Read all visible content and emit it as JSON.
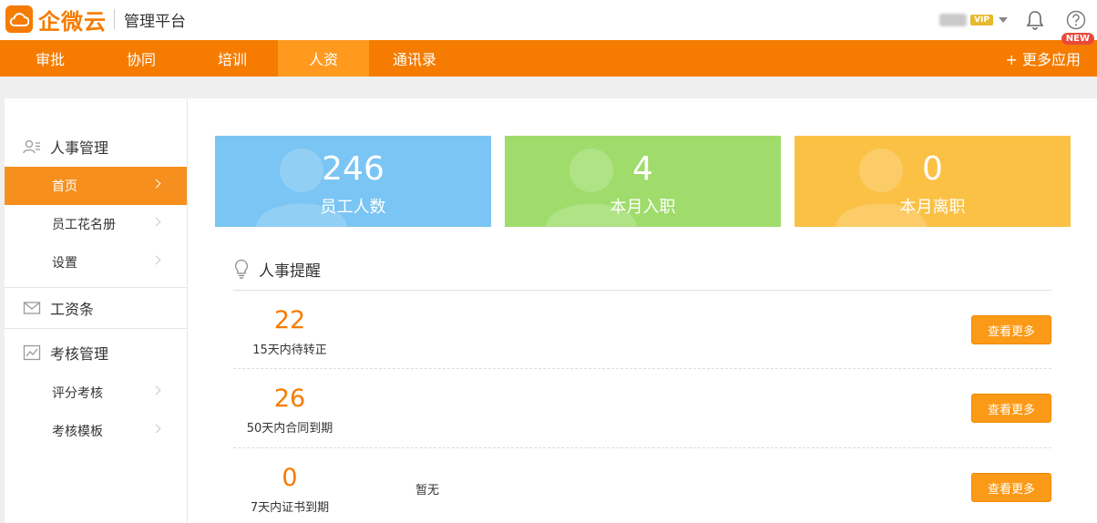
{
  "header": {
    "brand": "企微云",
    "subtitle": "管理平台",
    "vip_badge": "VIP"
  },
  "nav": {
    "items": [
      {
        "label": "审批"
      },
      {
        "label": "协同"
      },
      {
        "label": "培训"
      },
      {
        "label": "人资"
      },
      {
        "label": "通讯录"
      }
    ],
    "active_index": 3,
    "more_apps": "+ 更多应用",
    "new_badge": "NEW"
  },
  "sidebar": {
    "groups": [
      {
        "label": "人事管理",
        "icon": "user-card-icon",
        "items": [
          {
            "label": "首页",
            "active": true
          },
          {
            "label": "员工花名册"
          },
          {
            "label": "设置"
          }
        ]
      },
      {
        "label": "工资条",
        "icon": "envelope-icon",
        "items": []
      },
      {
        "label": "考核管理",
        "icon": "chart-icon",
        "items": [
          {
            "label": "评分考核"
          },
          {
            "label": "考核模板"
          }
        ]
      }
    ]
  },
  "stats": [
    {
      "value": "246",
      "label": "员工人数",
      "color": "#7ac5f3"
    },
    {
      "value": "4",
      "label": "本月入职",
      "color": "#9fdc6b"
    },
    {
      "value": "0",
      "label": "本月离职",
      "color": "#fbc145"
    }
  ],
  "reminders": {
    "title": "人事提醒",
    "rows": [
      {
        "count": "22",
        "label": "15天内待转正",
        "note": "",
        "button": "查看更多"
      },
      {
        "count": "26",
        "label": "50天内合同到期",
        "note": "",
        "button": "查看更多"
      },
      {
        "count": "0",
        "label": "7天内证书到期",
        "note": "暂无",
        "button": "查看更多"
      }
    ]
  },
  "colors": {
    "brand": "#f57c00",
    "nav_active": "#ff9a1f",
    "sidebar_active": "#f78f1e"
  }
}
